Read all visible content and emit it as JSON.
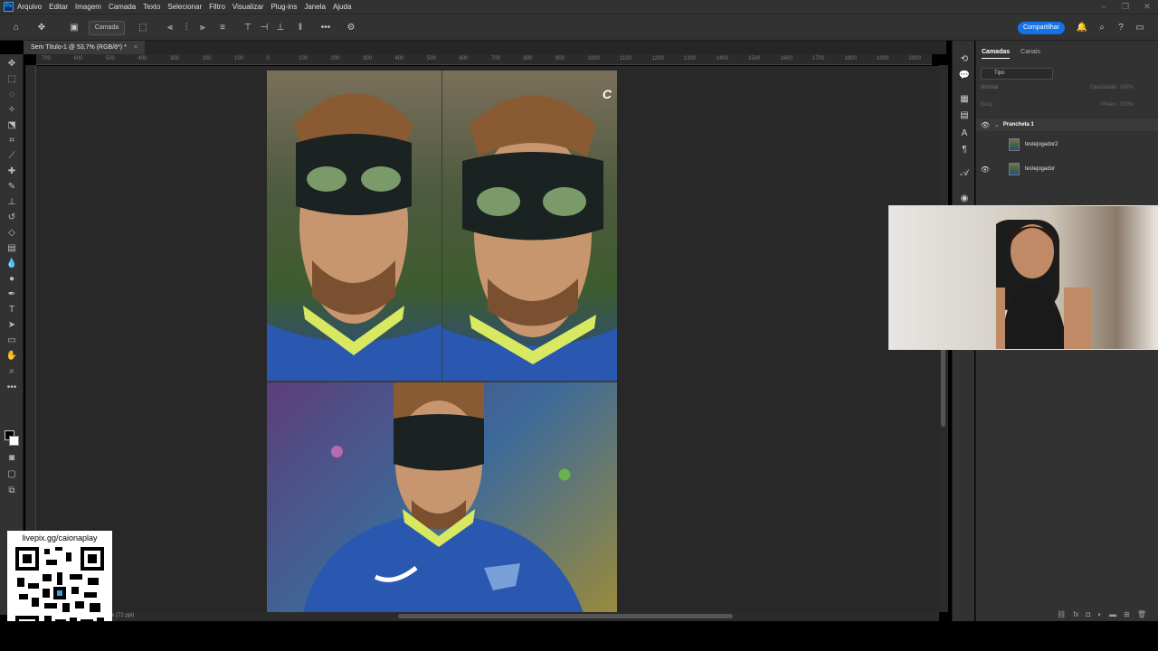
{
  "menu": {
    "logo": "Ps",
    "items": [
      "Arquivo",
      "Editar",
      "Imagem",
      "Camada",
      "Texto",
      "Selecionar",
      "Filtro",
      "Visualizar",
      "Plug-ins",
      "Janela",
      "Ajuda"
    ]
  },
  "options_bar": {
    "layer_select": "Camada",
    "share_label": "Compartilhar"
  },
  "document": {
    "tab_title": "Sem Título-1 @ 53,7% (RGB/8*) *",
    "status": "px (72 ppi)"
  },
  "ruler_ticks": [
    "700",
    "600",
    "500",
    "400",
    "300",
    "200",
    "100",
    "0",
    "100",
    "200",
    "300",
    "400",
    "500",
    "600",
    "700",
    "800",
    "900",
    "1000",
    "1100",
    "1200",
    "1300",
    "1400",
    "1500",
    "1600",
    "1700",
    "1800",
    "1900",
    "2000"
  ],
  "layers_panel": {
    "tabs": [
      "Camadas",
      "Canais"
    ],
    "active_tab": "Camadas",
    "filter_kind": "Tipo",
    "blend_mode": "Normal",
    "opacity_label": "Opacidade: 100%",
    "lock_label": "Bloq.:",
    "fill_label": "Preen.: 100%",
    "group_name": "Prancheta 1",
    "layers": [
      {
        "name": "testejogador2",
        "visible": false
      },
      {
        "name": "testejogador",
        "visible": true
      }
    ]
  },
  "overlay": {
    "qr_url": "livepix.gg/caionaplay"
  },
  "colors": {
    "accent": "#1473e6",
    "panel_bg": "#323232",
    "canvas_bg": "#282828"
  }
}
